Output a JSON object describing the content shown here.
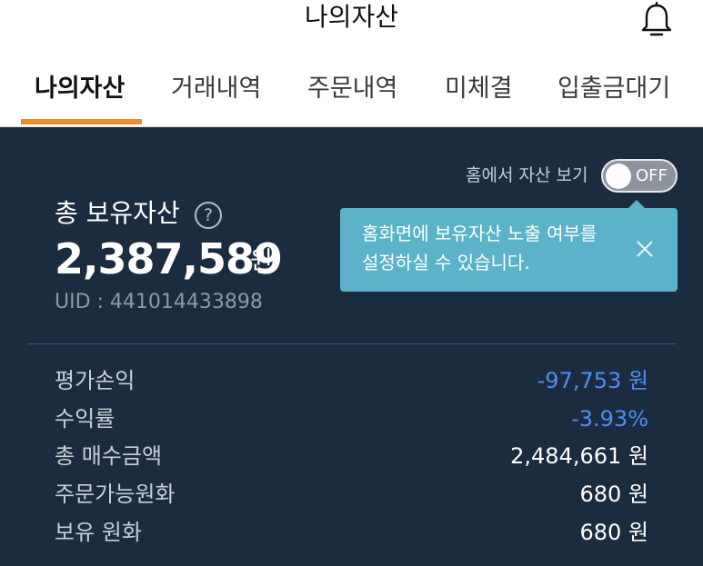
{
  "header": {
    "title": "나의자산",
    "bell_icon": "bell-icon"
  },
  "tabs": [
    {
      "label": "나의자산",
      "active": true
    },
    {
      "label": "거래내역",
      "active": false
    },
    {
      "label": "주문내역",
      "active": false
    },
    {
      "label": "미체결",
      "active": false
    },
    {
      "label": "입출금대기",
      "active": false
    }
  ],
  "colors": {
    "accent": "#f08a24",
    "panel_bg": "#1c2c40",
    "tooltip_bg": "#5cb3c9",
    "negative": "#4d8ff0"
  },
  "home_toggle": {
    "label": "홈에서 자산 보기",
    "state": "OFF"
  },
  "summary": {
    "total_label": "총 보유자산",
    "help_icon": "help-circle-icon",
    "help_symbol": "?",
    "total_value": "2,387,589",
    "total_unit": "원",
    "uid": "UID : 441014433898"
  },
  "tooltip": {
    "line1": "홈화면에 보유자산 노출 여부를",
    "line2": "설정하실 수 있습니다.",
    "close_icon": "close-icon"
  },
  "details": [
    {
      "label": "평가손익",
      "value": "-97,753 원",
      "negative": true
    },
    {
      "label": "수익률",
      "value": "-3.93%",
      "negative": true
    },
    {
      "label": "총 매수금액",
      "value": "2,484,661 원",
      "negative": false
    },
    {
      "label": "주문가능원화",
      "value": "680 원",
      "negative": false
    },
    {
      "label": "보유 원화",
      "value": "680 원",
      "negative": false
    }
  ]
}
